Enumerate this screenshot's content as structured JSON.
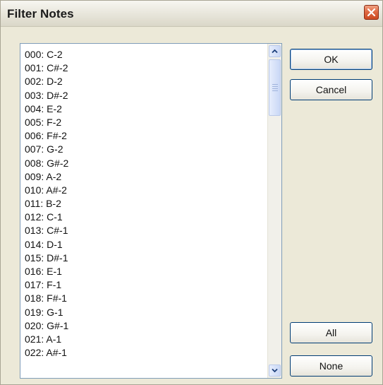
{
  "window": {
    "title": "Filter Notes"
  },
  "buttons": {
    "ok": "OK",
    "cancel": "Cancel",
    "all": "All",
    "none": "None"
  },
  "icons": {
    "close": "close-icon",
    "scroll_up": "arrow-up-icon",
    "scroll_down": "arrow-down-icon"
  },
  "colors": {
    "dialog_bg": "#ece9d8",
    "close_button": "#e06a44",
    "listbox_border": "#7f9db9",
    "button_border": "#003c74"
  },
  "notes_list": {
    "items": [
      "000: C-2",
      "001: C#-2",
      "002: D-2",
      "003: D#-2",
      "004: E-2",
      "005: F-2",
      "006: F#-2",
      "007: G-2",
      "008: G#-2",
      "009: A-2",
      "010: A#-2",
      "011: B-2",
      "012: C-1",
      "013: C#-1",
      "014: D-1",
      "015: D#-1",
      "016: E-1",
      "017: F-1",
      "018: F#-1",
      "019: G-1",
      "020: G#-1",
      "021: A-1",
      "022: A#-1"
    ]
  }
}
